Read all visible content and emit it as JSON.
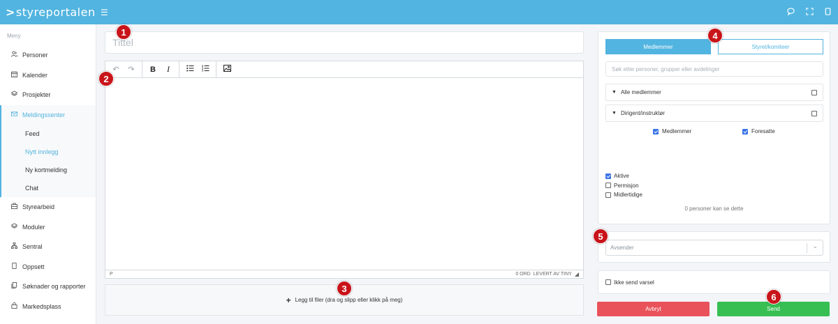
{
  "app": {
    "logo_mark": ">",
    "logo_text": "styreportalen"
  },
  "topbar": {
    "menu_icon": "hamburger-icon",
    "icons": [
      "chat-icon",
      "fullscreen-icon",
      "sidebar-icon"
    ]
  },
  "sidebar": {
    "menu_title": "Meny",
    "items_top": [
      {
        "label": "Personer",
        "icon": "persons-icon"
      },
      {
        "label": "Kalender",
        "icon": "calendar-icon"
      },
      {
        "label": "Prosjekter",
        "icon": "layers-icon"
      },
      {
        "label": "Meldingssenter",
        "icon": "mail-icon"
      }
    ],
    "sub_items": [
      {
        "label": "Feed"
      },
      {
        "label": "Nytt innlegg"
      },
      {
        "label": "Ny kortmelding"
      },
      {
        "label": "Chat"
      }
    ],
    "items_bottom": [
      {
        "label": "Styrearbeid",
        "icon": "board-icon"
      },
      {
        "label": "Moduler",
        "icon": "layers-icon"
      },
      {
        "label": "Sentral",
        "icon": "hierarchy-icon"
      },
      {
        "label": "Oppsett",
        "icon": "settings-icon"
      },
      {
        "label": "Søknader og rapporter",
        "icon": "documents-icon"
      },
      {
        "label": "Markedsplass",
        "icon": "shop-icon"
      }
    ]
  },
  "post": {
    "title_placeholder": "Tittel"
  },
  "editor": {
    "status_left": "P",
    "word_count": "0 ORD",
    "powered_by": "LEVERT AV TINY"
  },
  "dropzone": {
    "label": "Legg til filer (dra og slipp eller klikk på meg)"
  },
  "recipients": {
    "tab_members": "Medlemmer",
    "tab_board": "Styret/komiteer",
    "search_placeholder": "Søk etter personer, grupper eller avdelinger",
    "groups": [
      {
        "label": "Alle medlemmer",
        "checked": false
      },
      {
        "label": "Dirigent/instruktør",
        "checked": false
      }
    ],
    "sub_options": [
      {
        "label": "Medlemmer",
        "checked": true
      },
      {
        "label": "Foresatte",
        "checked": true
      }
    ],
    "statuses": [
      {
        "label": "Aktive",
        "checked": true
      },
      {
        "label": "Permisjon",
        "checked": false
      },
      {
        "label": "Midlertidige",
        "checked": false
      }
    ],
    "count_text": "0 personer kan se dette"
  },
  "sender": {
    "placeholder": "Avsender"
  },
  "notify": {
    "label": "Ikke send varsel",
    "checked": false
  },
  "actions": {
    "cancel": "Avbryt",
    "send": "Send"
  },
  "colors": {
    "brand": "#52b4e0",
    "cancel": "#e9525a",
    "send": "#37bf53",
    "marker": "#c8141a"
  },
  "markers": [
    "1",
    "2",
    "3",
    "4",
    "5",
    "6"
  ]
}
